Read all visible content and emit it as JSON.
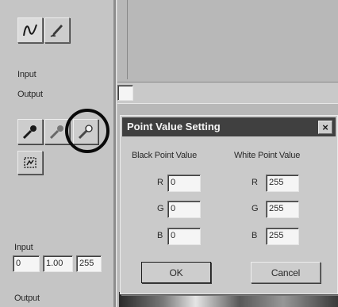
{
  "left_panel": {
    "curve_mode_buttons": [
      {
        "icon": "curve-icon",
        "state": "pressed"
      },
      {
        "icon": "freehand-pen-icon",
        "state": "normal"
      }
    ],
    "input_label": "Input",
    "output_label": "Output",
    "eyedroppers": [
      {
        "icon": "black-point-eyedropper-icon"
      },
      {
        "icon": "gray-point-eyedropper-icon"
      },
      {
        "icon": "white-point-eyedropper-icon",
        "highlighted": true
      }
    ],
    "reset_icon": "auto-adjust-icon",
    "input_levels_label": "Input",
    "input_levels": {
      "black": "0",
      "gamma": "1.00",
      "white": "255"
    },
    "output_levels_label": "Output"
  },
  "dialog": {
    "title": "Point Value Setting",
    "close_label": "×",
    "black_header": "Black Point Value",
    "white_header": "White Point Value",
    "channels": [
      "R",
      "G",
      "B"
    ],
    "black_values": [
      "0",
      "0",
      "0"
    ],
    "white_values": [
      "255",
      "255",
      "255"
    ],
    "ok_label": "OK",
    "cancel_label": "Cancel"
  },
  "colors": {
    "title_bar": "#3a3a3a",
    "background": "#c9c9c9",
    "highlight_circle": "#000000"
  }
}
